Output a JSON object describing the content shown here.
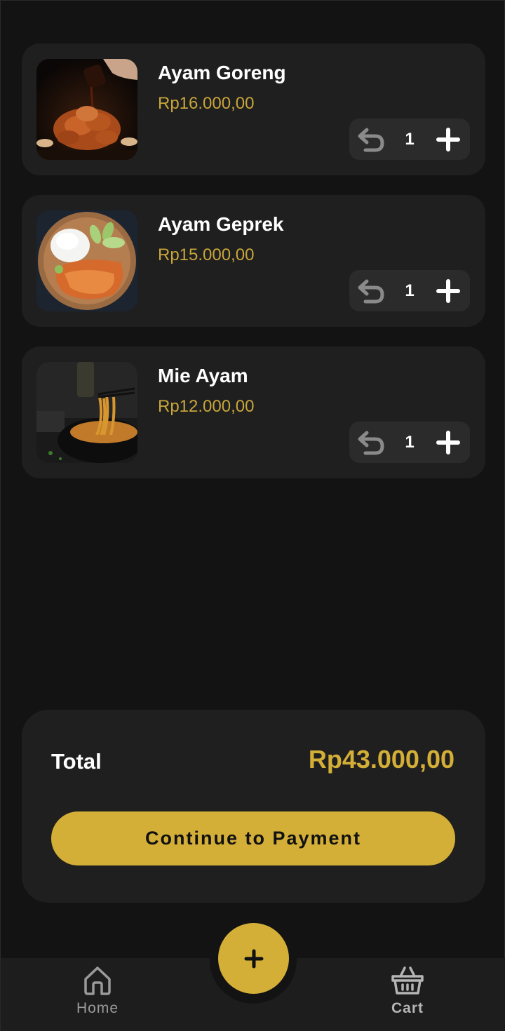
{
  "cart": {
    "items": [
      {
        "name": "Ayam Goreng",
        "price": "Rp16.000,00",
        "quantity": "1",
        "image": "fried-chicken-photo"
      },
      {
        "name": "Ayam Geprek",
        "price": "Rp15.000,00",
        "quantity": "1",
        "image": "ayam-geprek-plate-photo"
      },
      {
        "name": "Mie Ayam",
        "price": "Rp12.000,00",
        "quantity": "1",
        "image": "noodle-bowl-photo"
      }
    ],
    "decrease_icon": "undo-arrow-icon",
    "increase_icon": "plus-icon"
  },
  "summary": {
    "total_label": "Total",
    "total_value": "Rp43.000,00",
    "button_label": "Continue to Payment"
  },
  "nav": {
    "home_label": "Home",
    "cart_label": "Cart",
    "fab_icon": "plus-icon"
  },
  "colors": {
    "background": "#131313",
    "card": "#1f1f1f",
    "accent": "#d4af37",
    "price": "#c8a53a"
  }
}
